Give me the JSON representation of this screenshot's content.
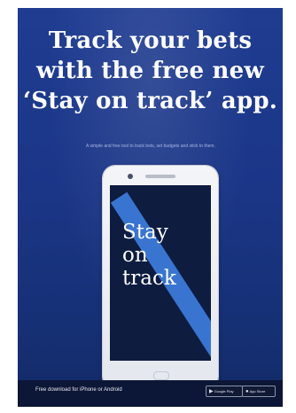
{
  "poster": {
    "headline": [
      "Track your bets",
      "with the free new",
      "‘Stay on track’ app."
    ],
    "subline": "A simple and free tool to track bets, set budgets and stick to them.",
    "app_title": [
      "Stay",
      "on",
      "track"
    ],
    "footer_text": "Free download for iPhone or Android",
    "fine_print": "",
    "stores": {
      "google": {
        "label": "Google Play",
        "icon": "play-store-icon"
      },
      "apple": {
        "label": "App Store",
        "icon": "apple-icon"
      }
    }
  },
  "colors": {
    "poster_blue": "#1b3687",
    "footer_navy": "#0c1636",
    "screen_dark": "#0e1c40",
    "stripe_blue": "#3c7ad8"
  }
}
